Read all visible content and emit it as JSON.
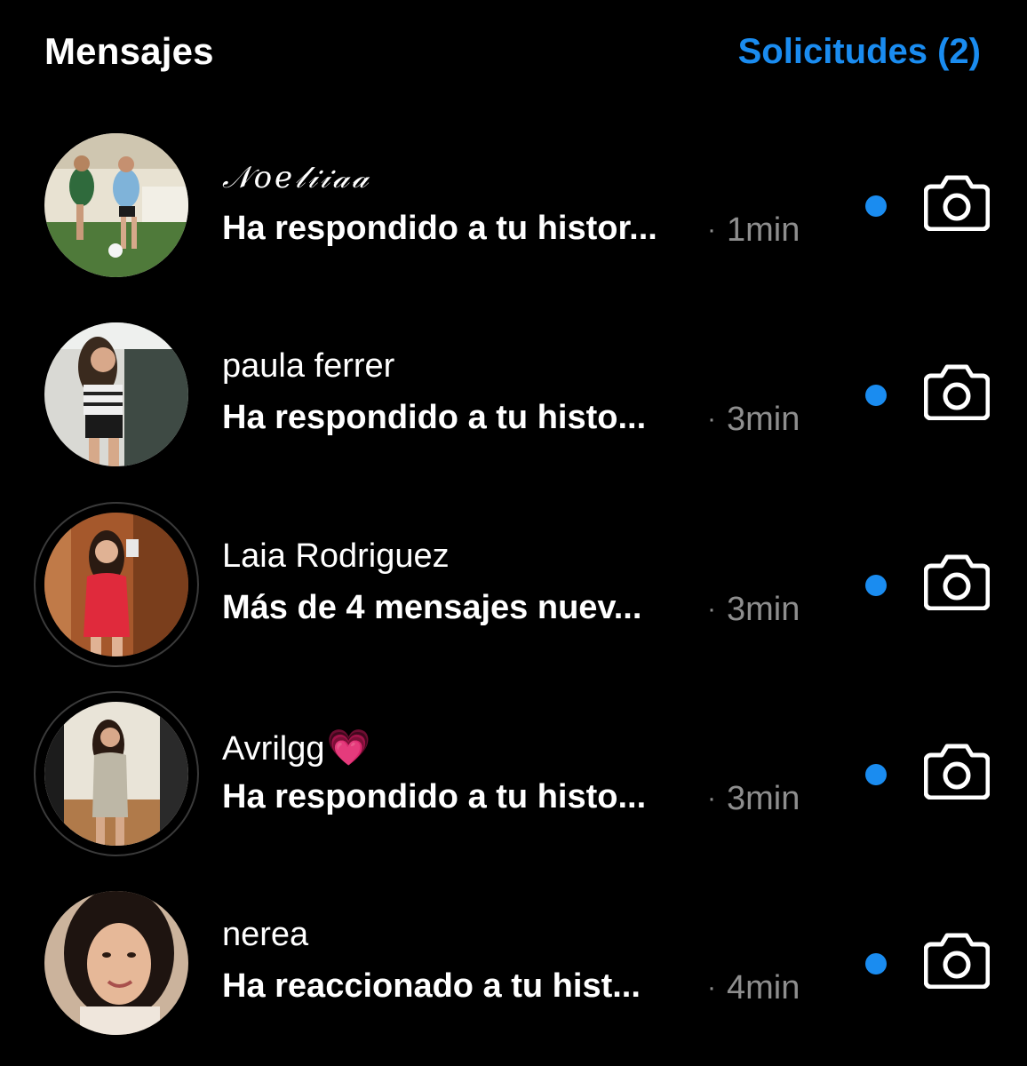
{
  "header": {
    "title": "Mensajes",
    "requests_label": "Solicitudes (2)"
  },
  "colors": {
    "background": "#000000",
    "accent": "#1a8cf0",
    "muted": "#8e8e8e",
    "heart": "#e85ad8"
  },
  "threads": [
    {
      "name": "𝒩𝑜𝑒𝓁𝒾𝒾𝒶𝒶",
      "preview": "Ha respondido a tu histor...",
      "time": "1min",
      "separator": "·",
      "unread": true,
      "icon": "camera-icon"
    },
    {
      "name": "paula ferrer",
      "preview": "Ha respondido a tu histo...",
      "time": "3min",
      "separator": "·",
      "unread": true,
      "icon": "camera-icon"
    },
    {
      "name": "Laia Rodriguez",
      "preview": "Más de 4 mensajes nuev...",
      "time": "3min",
      "separator": "·",
      "unread": true,
      "icon": "camera-icon"
    },
    {
      "name": "Avrilgg",
      "name_emoji": "💗",
      "preview": "Ha respondido a tu histo...",
      "time": "3min",
      "separator": "·",
      "unread": true,
      "icon": "camera-icon"
    },
    {
      "name": "nerea",
      "preview": "Ha reaccionado a tu hist...",
      "time": "4min",
      "separator": "·",
      "unread": true,
      "icon": "camera-icon"
    }
  ]
}
